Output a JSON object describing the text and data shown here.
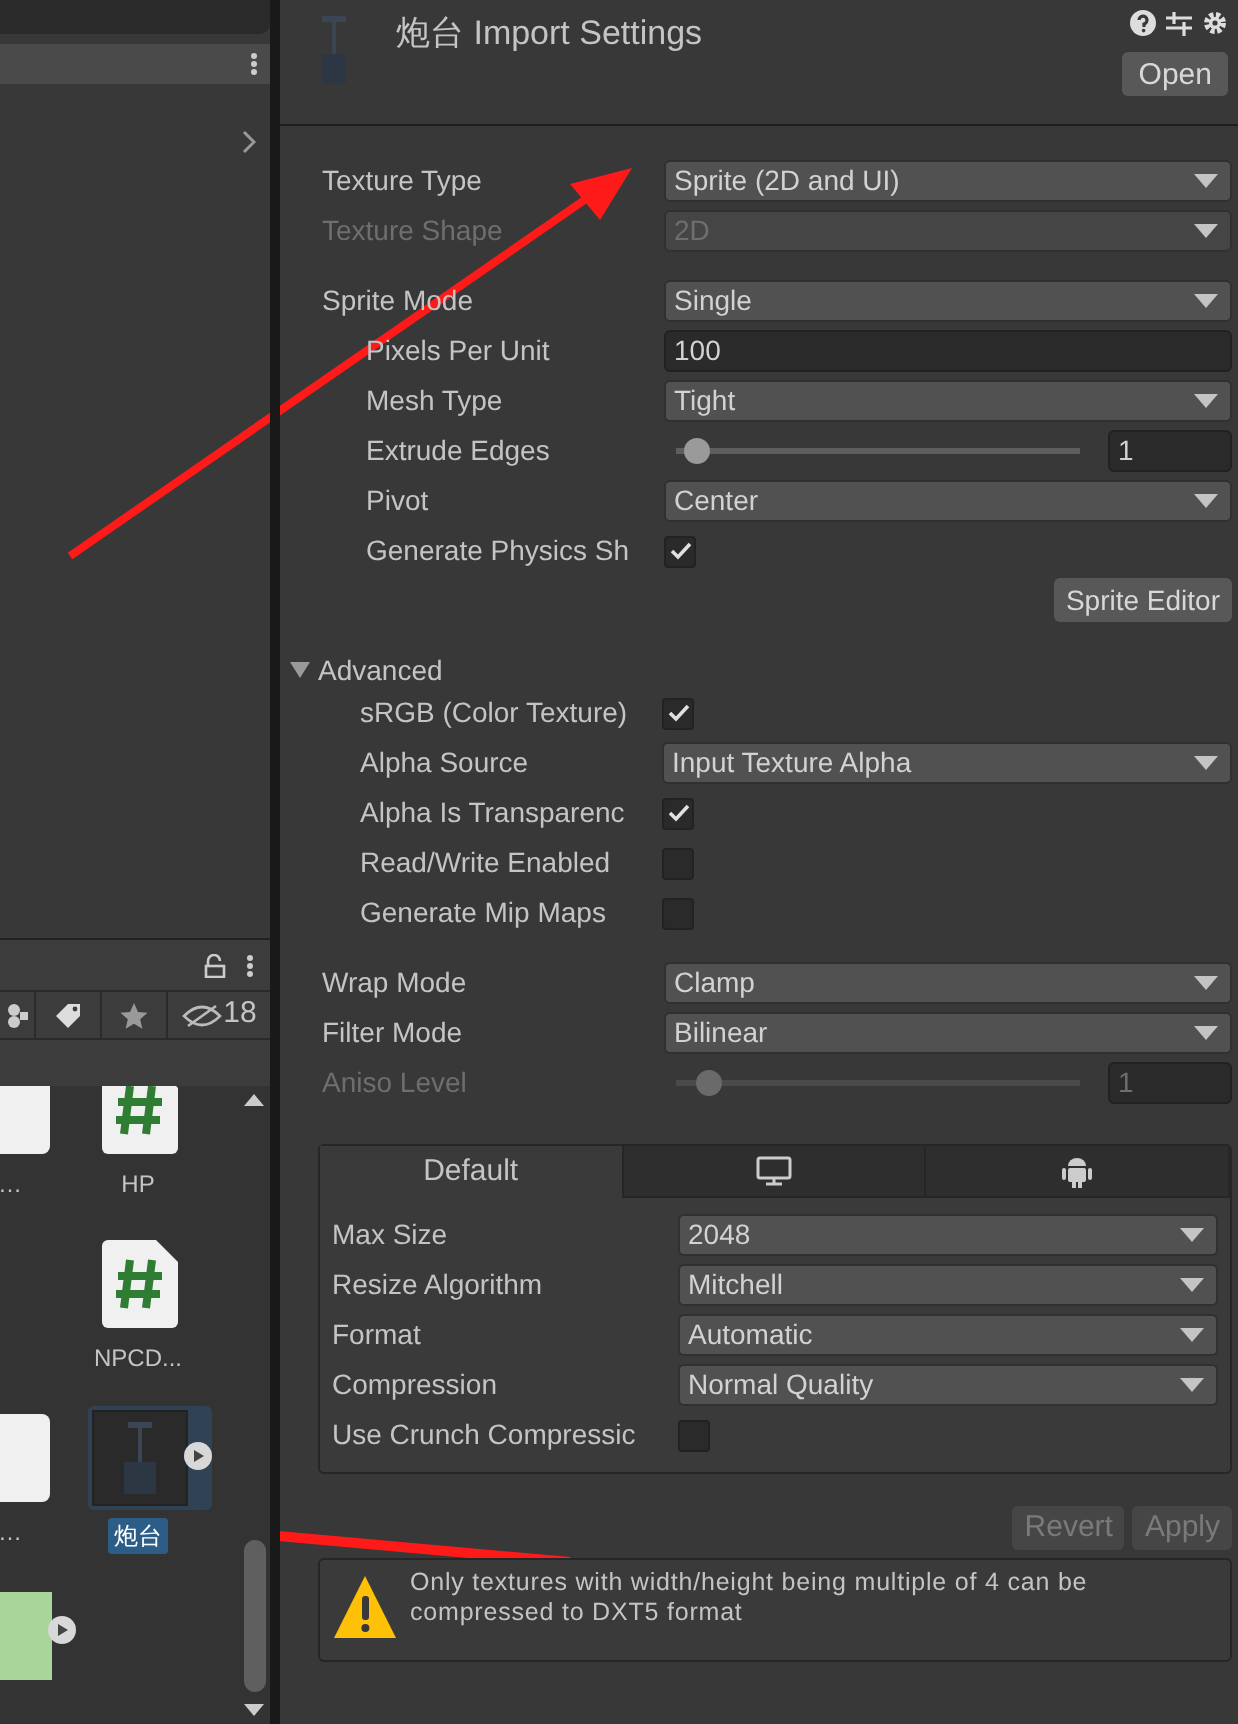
{
  "project": {
    "hidden_count": "18",
    "assets": [
      {
        "label": "…",
        "kind": "doc",
        "selected": false
      },
      {
        "label": "HP",
        "kind": "script",
        "selected": false
      },
      {
        "label": "NPCD...",
        "kind": "script",
        "selected": false
      },
      {
        "label": "…",
        "kind": "doc",
        "selected": false
      },
      {
        "label": "炮台",
        "kind": "sprite",
        "selected": true
      },
      {
        "kind": "image",
        "selected": false
      }
    ]
  },
  "inspector": {
    "title": "炮台 Import Settings",
    "open_button": "Open",
    "settings": [
      {
        "kind": "dropdown",
        "label": "Texture Type",
        "value": "Sprite (2D and UI)",
        "disabled": false
      },
      {
        "kind": "dropdown",
        "label": "Texture Shape",
        "value": "2D",
        "disabled": true
      },
      {
        "kind": "dropdown",
        "label": "Sprite Mode",
        "value": "Single",
        "disabled": false,
        "children": [
          {
            "kind": "field",
            "label": "Pixels Per Unit",
            "value": "100",
            "disabled": false
          },
          {
            "kind": "dropdown",
            "label": "Mesh Type",
            "value": "Tight",
            "disabled": false
          },
          {
            "kind": "slider",
            "label": "Extrude Edges",
            "value": "1",
            "level": 0.05,
            "disabled": false
          },
          {
            "kind": "dropdown",
            "label": "Pivot",
            "value": "Center",
            "disabled": false
          },
          {
            "kind": "checkbox",
            "label": "Generate Physics Sh",
            "checked": true,
            "disabled": false
          }
        ]
      }
    ],
    "sprite_editor_button": "Sprite Editor",
    "advanced": {
      "label": "Advanced",
      "expanded": true,
      "children": [
        {
          "kind": "checkbox",
          "label": "sRGB (Color Texture)",
          "checked": true,
          "disabled": false
        },
        {
          "kind": "dropdown",
          "label": "Alpha Source",
          "value": "Input Texture Alpha",
          "disabled": false
        },
        {
          "kind": "checkbox",
          "label": "Alpha Is Transparenc",
          "checked": true,
          "disabled": false
        },
        {
          "kind": "checkbox",
          "label": "Read/Write Enabled",
          "checked": false,
          "disabled": false
        },
        {
          "kind": "checkbox",
          "label": "Generate Mip Maps",
          "checked": false,
          "disabled": false
        }
      ]
    },
    "settings2": [
      {
        "kind": "dropdown",
        "label": "Wrap Mode",
        "value": "Clamp",
        "disabled": false
      },
      {
        "kind": "dropdown",
        "label": "Filter Mode",
        "value": "Bilinear",
        "disabled": false
      },
      {
        "kind": "slider",
        "label": "Aniso Level",
        "value": "1",
        "level": 0.08,
        "disabled": true
      }
    ],
    "platform_tabs": [
      {
        "kind": "text",
        "label": "Default",
        "selected": true
      },
      {
        "kind": "monitor",
        "selected": false
      },
      {
        "kind": "android",
        "selected": false
      }
    ],
    "platform_settings": [
      {
        "kind": "dropdown",
        "label": "Max Size",
        "value": "2048",
        "disabled": false
      },
      {
        "kind": "dropdown",
        "label": "Resize Algorithm",
        "value": "Mitchell",
        "disabled": false
      },
      {
        "kind": "dropdown",
        "label": "Format",
        "value": "Automatic",
        "disabled": false
      },
      {
        "kind": "dropdown",
        "label": "Compression",
        "value": "Normal Quality",
        "disabled": false
      },
      {
        "kind": "checkbox",
        "label": "Use Crunch Compressic",
        "checked": false,
        "disabled": false
      }
    ],
    "buttons": [
      {
        "label": "Revert",
        "disabled": true
      },
      {
        "label": "Apply",
        "disabled": true
      }
    ],
    "warning": "Only textures with width/height being multiple of 4 can be compressed to DXT5 format"
  }
}
